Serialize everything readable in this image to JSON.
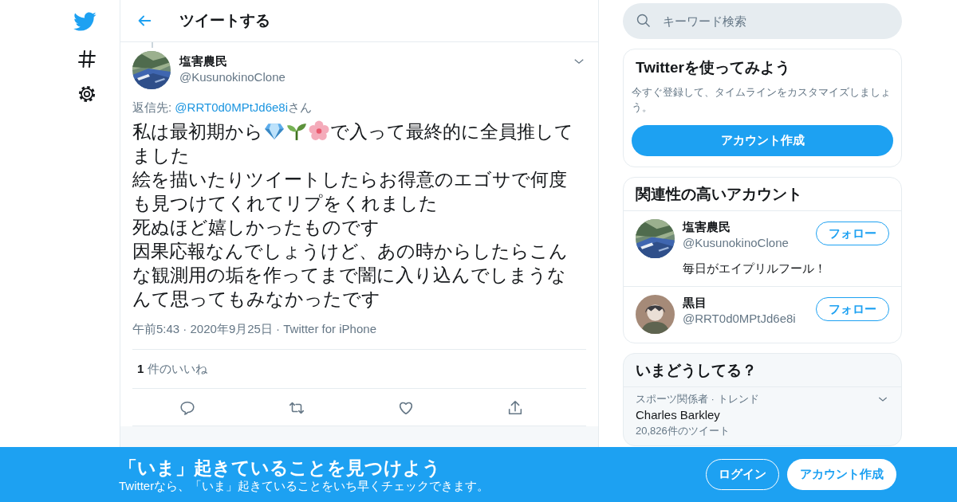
{
  "header": {
    "title": "ツイートする"
  },
  "tweet": {
    "name": "塩害農民",
    "handle": "@KusunokinoClone",
    "reply_to": {
      "label": "返信先: ",
      "handle": "@RRT0d0MPtJd6e8i",
      "suffix": "さん"
    },
    "body": [
      [
        {
          "kind": "text",
          "text": "私は最初期から"
        },
        {
          "kind": "emoji"
        },
        {
          "kind": "emoji"
        },
        {
          "kind": "emoji"
        },
        {
          "kind": "text",
          "text": "で入って最終的に全員推して"
        }
      ],
      [
        {
          "kind": "text",
          "text": "ました"
        }
      ],
      [
        {
          "kind": "text",
          "text": "絵を描いたりツイートしたらお得意のエゴサで何度も見つけてくれてリプをくれました"
        }
      ],
      [
        {
          "kind": "text",
          "text": "死ぬほど嬉しかったものです"
        }
      ],
      [
        {
          "kind": "text",
          "text": "因果応報なんでしょうけど、あの時からしたらこんな観測用の垢を作ってまで闇に入り込んでしまうなんて思ってもみなかったです"
        }
      ]
    ],
    "meta": "午前5:43 · 2020年9月25日 · Twitter for iPhone",
    "likes": {
      "count": "1",
      "label": "件のいいね"
    }
  },
  "search": {
    "placeholder": "キーワード検索"
  },
  "signup_card": {
    "title": "Twitterを使ってみよう",
    "text": "今すぐ登録して、タイムラインをカスタマイズしましょう。",
    "button": "アカウント作成"
  },
  "related": {
    "title": "関連性の高いアカウント",
    "accounts": [
      {
        "kind": "picture",
        "name": "塩害農民",
        "handle": "@KusunokinoClone",
        "bio": "毎日がエイプリルフール！",
        "button": "フォロー"
      },
      {
        "kind": "avatar",
        "name": "黒目",
        "handle": "@RRT0d0MPtJd6e8i",
        "button": "フォロー"
      }
    ]
  },
  "trends": {
    "title": "いまどうしてる？",
    "items": [
      {
        "context": "スポーツ関係者 · トレンド",
        "name": "Charles Barkley",
        "count": "20,826件のツイート"
      }
    ]
  },
  "banner": {
    "title": "「いま」起きていることを見つけよう",
    "text": "Twitterなら、「いま」起きていることをいち早くチェックできます。",
    "login": "ログイン",
    "signup": "アカウント作成"
  }
}
